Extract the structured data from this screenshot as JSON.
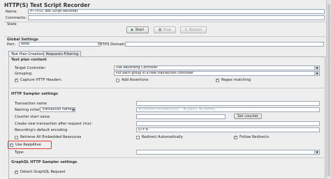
{
  "title": "HTTP(S) Test Script Recorder",
  "name_label": "Name:",
  "name_value": "HTTP(S) Test Script Recorder",
  "comments_label": "Comments:",
  "state_label": "State",
  "buttons": {
    "start": "Start",
    "stop": "Stop",
    "restart": "Restart"
  },
  "global_settings": {
    "title": "Global Settings",
    "port_label": "Port:",
    "port_value": "8888",
    "https_domains_label": "HTTPS Domains:"
  },
  "tabs": [
    {
      "label": "Test Plan Creation"
    },
    {
      "label": "Requests Filtering"
    }
  ],
  "test_plan": {
    "section": "Test plan content",
    "target_label": "Target Controller:",
    "target_value": "Use Recording Controller",
    "grouping_label": "Grouping:",
    "grouping_value": "Put each group in a new transaction controller",
    "capture_headers": "Capture HTTP Headers",
    "add_assertions": "Add Assertions",
    "regex_matching": "Regex matching"
  },
  "http_sampler": {
    "section": "HTTP Sampler settings",
    "transaction_name_label": "Transaction name",
    "naming_scheme_label": "Naming scheme",
    "naming_scheme_value": "Transaction name",
    "naming_placeholder": "#{counter,number,000} - #{path} #{name}",
    "counter_start_label": "Counter start value",
    "set_counter": "Set counter",
    "create_new_label": "Create new transaction after request (ms):",
    "encoding_label": "Recording's default encoding",
    "encoding_value": "UTF-8",
    "retrieve_all": "Retrieve All Embedded Resources",
    "redirect_auto": "Redirect Automatically",
    "follow_redirects": "Follow Redirects",
    "use_keepalive": "Use KeepAlive",
    "type_label": "Type:"
  },
  "graphql": {
    "section": "GraphQL HTTP Sampler settings",
    "detect": "Detect GraphQL Request"
  },
  "colors": {
    "highlight": "#e53935",
    "background": "#eeeeee"
  }
}
